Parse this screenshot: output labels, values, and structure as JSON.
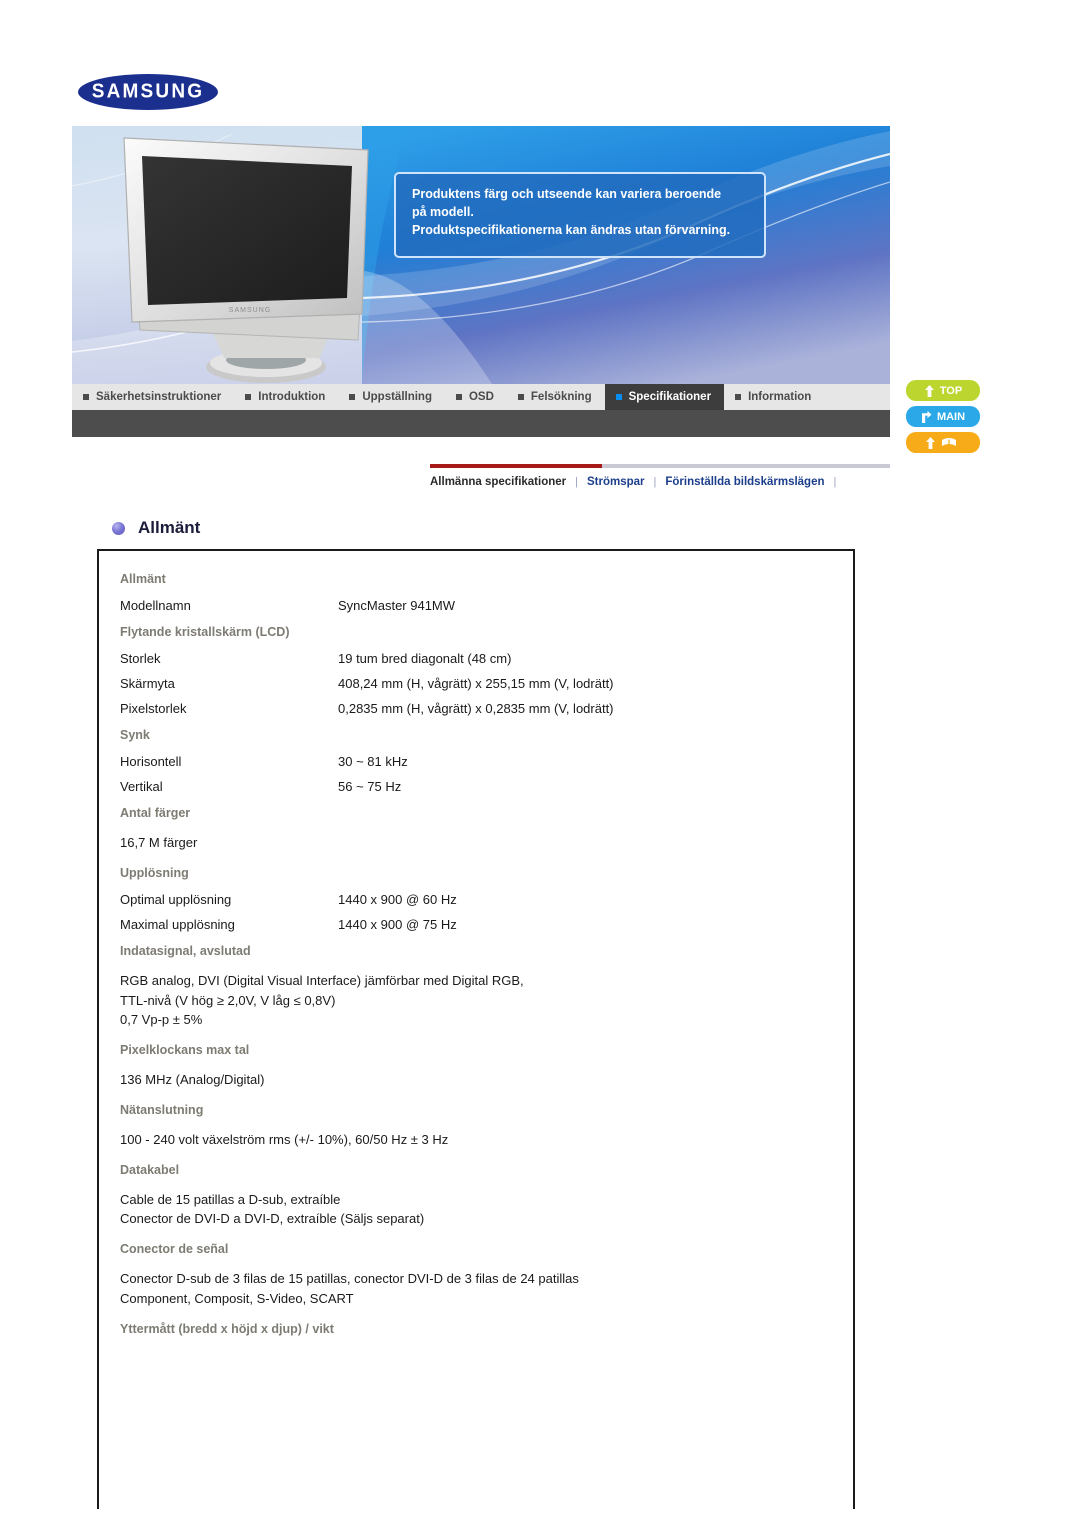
{
  "brand": {
    "logo_text": "SAMSUNG"
  },
  "hero": {
    "note_lines": [
      "Produktens färg och utseende kan variera beroende",
      "på modell.",
      "Produktspecifikationerna kan ändras utan förvarning."
    ],
    "monitor_brand_label": "SAMSUNG"
  },
  "nav": {
    "items": [
      {
        "label": "Säkerhetsinstruktioner",
        "active": false
      },
      {
        "label": "Introduktion",
        "active": false
      },
      {
        "label": "Uppställning",
        "active": false
      },
      {
        "label": "OSD",
        "active": false
      },
      {
        "label": "Felsökning",
        "active": false
      },
      {
        "label": "Specifikationer",
        "active": true
      },
      {
        "label": "Information",
        "active": false
      }
    ]
  },
  "side_buttons": [
    {
      "label": "TOP",
      "icon": "up-arrow-icon",
      "color": "#bcd62f"
    },
    {
      "label": "MAIN",
      "icon": "home-arrow-icon",
      "color": "#2aa8e8"
    },
    {
      "label": "",
      "icon": "up-arrow-book-icon",
      "color": "#f7ab18"
    }
  ],
  "subnav": {
    "items": [
      {
        "label": "Allmänna specifikationer",
        "active": true
      },
      {
        "label": "Strömspar",
        "active": false
      },
      {
        "label": "Förinställda bildskärmslägen",
        "active": false
      }
    ],
    "separator": "|"
  },
  "section": {
    "title": "Allmänt"
  },
  "spec": {
    "groups": [
      {
        "heading": "Allmänt",
        "type": "rows",
        "rows": [
          {
            "key": "Modellnamn",
            "value": "SyncMaster 941MW"
          }
        ]
      },
      {
        "heading": "Flytande kristallskärm (LCD)",
        "type": "rows",
        "rows": [
          {
            "key": "Storlek",
            "value": "19 tum bred diagonalt (48 cm)"
          },
          {
            "key": "Skärmyta",
            "value": "408,24 mm (H, vågrätt) x 255,15 mm (V, lodrätt)"
          },
          {
            "key": "Pixelstorlek",
            "value": "0,2835 mm (H, vågrätt) x 0,2835 mm (V, lodrätt)"
          }
        ]
      },
      {
        "heading": "Synk",
        "type": "rows",
        "rows": [
          {
            "key": "Horisontell",
            "value": "30 ~ 81 kHz"
          },
          {
            "key": "Vertikal",
            "value": "56 ~ 75 Hz"
          }
        ]
      },
      {
        "heading": "Antal färger",
        "type": "text",
        "text": "16,7 M färger"
      },
      {
        "heading": "Upplösning",
        "type": "rows",
        "rows": [
          {
            "key": "Optimal upplösning",
            "value": "1440 x 900 @ 60 Hz"
          },
          {
            "key": "Maximal upplösning",
            "value": "1440 x 900 @ 75 Hz"
          }
        ]
      },
      {
        "heading": "Indatasignal, avslutad",
        "type": "text",
        "text": "RGB analog, DVI (Digital Visual Interface) jämförbar med Digital RGB,\nTTL-nivå (V hög ≥ 2,0V, V låg ≤ 0,8V)\n0,7 Vp-p ± 5%"
      },
      {
        "heading": "Pixelklockans max tal",
        "type": "text",
        "text": "136 MHz (Analog/Digital)"
      },
      {
        "heading": "Nätanslutning",
        "type": "text",
        "text": "100 - 240 volt växelström rms (+/- 10%), 60/50 Hz ± 3 Hz"
      },
      {
        "heading": "Datakabel",
        "type": "text",
        "text": "Cable de 15 patillas a D-sub, extraíble\nConector de DVI-D a DVI-D, extraíble (Säljs separat)"
      },
      {
        "heading": "Conector de señal",
        "type": "text",
        "text": "Conector D-sub de 3 filas de 15 patillas, conector DVI-D de 3 filas de 24 patillas\nComponent, Composit, S-Video, SCART"
      },
      {
        "heading": "Yttermått (bredd x höjd x djup) / vikt",
        "type": "text",
        "text": ""
      }
    ]
  },
  "colors": {
    "brand_blue": "#1b2f8f",
    "nav_bg": "#e6e6e6",
    "nav_active_bg": "#3d3d3d",
    "nav_active_bullet": "#0a8ff0",
    "accent_red": "#a81a18",
    "link_blue": "#1b3e8c",
    "group_head_gray": "#7d7b72"
  }
}
